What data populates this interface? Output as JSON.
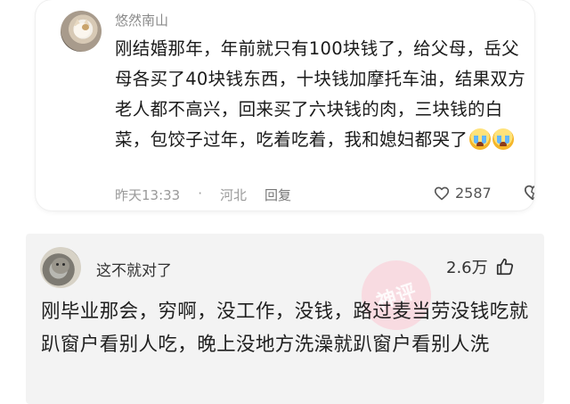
{
  "comments": [
    {
      "username": "悠然南山",
      "text": "刚结婚那年，年前就只有100块钱了，给父母，岳父母各买了40块钱东西，十块钱加摩托车油，结果双方老人都不高兴，回来买了六块钱的肉，三块钱的白菜，包饺子过年，吃着吃着，我和媳妇都哭了",
      "emojis": [
        "crying-face",
        "crying-face"
      ],
      "time": "昨天13:33",
      "location": "河北",
      "reply_label": "回复",
      "likes": "2587"
    },
    {
      "username": "这不就对了",
      "likes": "2.6万",
      "watermark": "神评",
      "text": "刚毕业那会，穷啊，没工作，没钱，路过麦当劳没钱吃就趴窗户看别人吃，晚上没地方洗澡就趴窗户看别人洗"
    }
  ],
  "colors": {
    "like_icon": "#555555",
    "watermark": "#ffbecd",
    "card_bottom_bg": "#f3f3f3"
  },
  "icons": [
    "heart-outline-icon",
    "dislike-heart-icon",
    "thumbs-up-icon"
  ]
}
